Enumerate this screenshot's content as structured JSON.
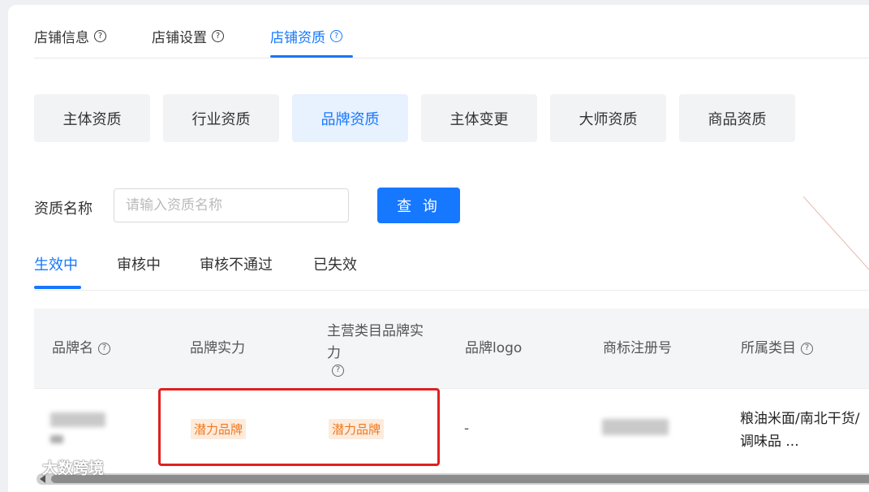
{
  "top_tabs": [
    {
      "label": "店铺信息"
    },
    {
      "label": "店铺设置"
    },
    {
      "label": "店铺资质"
    }
  ],
  "qualification_types": [
    "主体资质",
    "行业资质",
    "品牌资质",
    "主体变更",
    "大师资质",
    "商品资质"
  ],
  "search": {
    "label": "资质名称",
    "placeholder": "请输入资质名称",
    "button": "查 询"
  },
  "status_tabs": [
    "生效中",
    "审核中",
    "审核不通过",
    "已失效"
  ],
  "table": {
    "headers": [
      "品牌名",
      "品牌实力",
      "主营类目品牌实力",
      "品牌logo",
      "商标注册号",
      "所属类目"
    ],
    "rows": [
      {
        "brand_strength": "潜力品牌",
        "category_brand_strength": "潜力品牌",
        "brand_logo": "-",
        "category": "粮油米面/南北干货/调味品 ..."
      }
    ]
  },
  "watermark": "大数跨境",
  "colors": {
    "accent": "#1677ff",
    "tag_text": "#f0781e",
    "tag_bg": "#fdebdc",
    "highlight": "#e02020"
  }
}
